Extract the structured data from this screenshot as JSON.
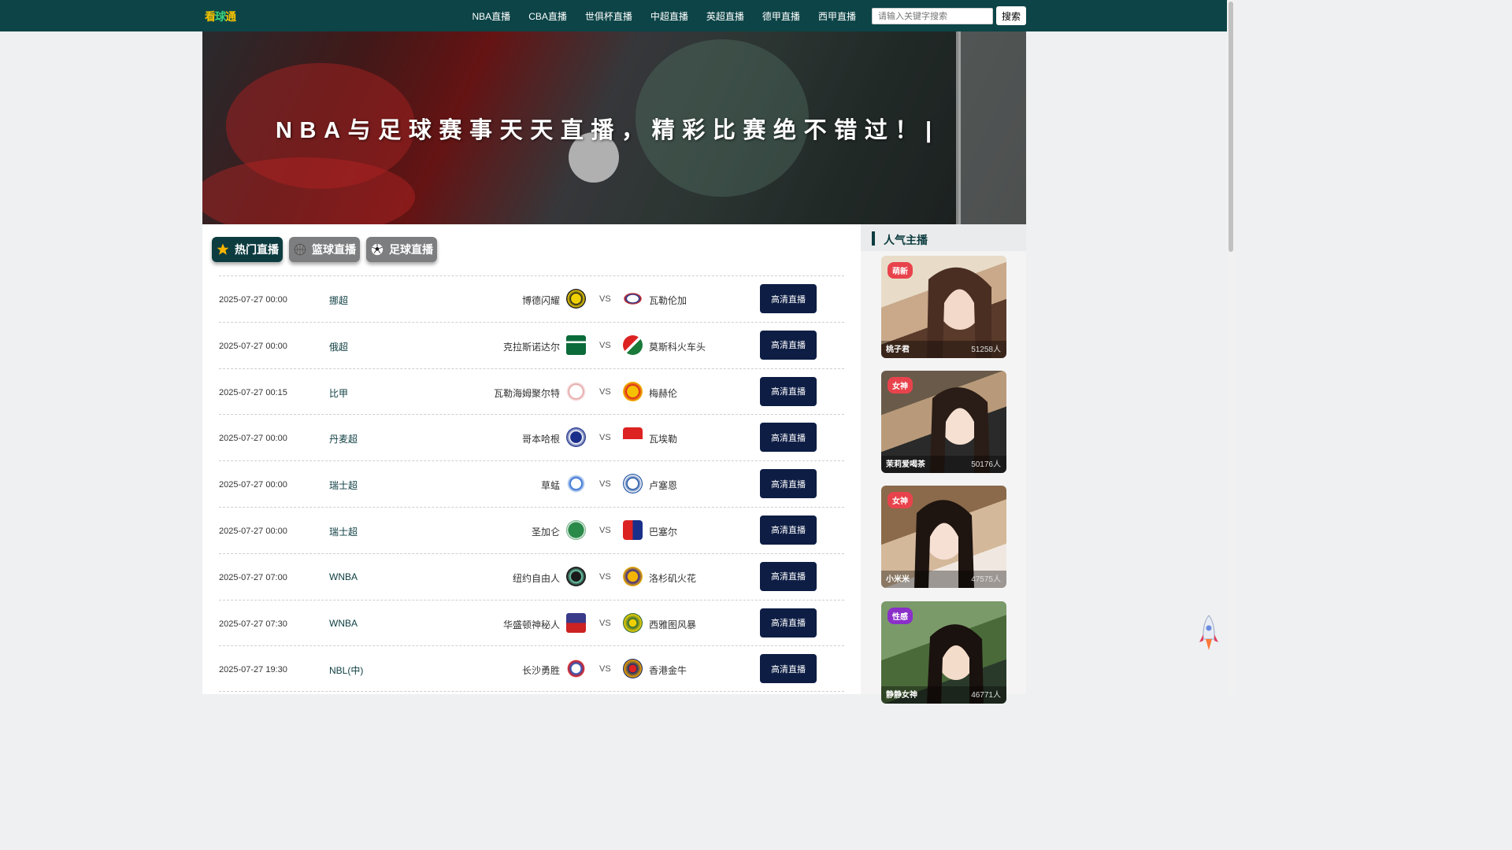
{
  "logo": {
    "parts": [
      "看",
      "球",
      "通"
    ]
  },
  "nav": [
    "NBA直播",
    "CBA直播",
    "世俱杯直播",
    "中超直播",
    "英超直播",
    "德甲直播",
    "西甲直播"
  ],
  "search": {
    "placeholder": "请输入关键字搜索",
    "button": "搜索"
  },
  "banner": {
    "title": "NBA与足球赛事天天直播，精彩比赛绝不错过！|"
  },
  "tabs": [
    {
      "label": "热门直播",
      "icon": "star-icon"
    },
    {
      "label": "篮球直播",
      "icon": "basketball-icon"
    },
    {
      "label": "足球直播",
      "icon": "soccer-ball-icon"
    }
  ],
  "matches": [
    {
      "time": "2025-07-27 00:00",
      "league": "挪超",
      "home": "博德闪耀",
      "vs": "VS",
      "away": "瓦勒伦加",
      "button": "高清直播"
    },
    {
      "time": "2025-07-27 00:00",
      "league": "俄超",
      "home": "克拉斯诺达尔",
      "vs": "VS",
      "away": "莫斯科火车头",
      "button": "高清直播"
    },
    {
      "time": "2025-07-27 00:15",
      "league": "比甲",
      "home": "瓦勒海姆聚尔特",
      "vs": "VS",
      "away": "梅赫伦",
      "button": "高清直播"
    },
    {
      "time": "2025-07-27 00:00",
      "league": "丹麦超",
      "home": "哥本哈根",
      "vs": "VS",
      "away": "瓦埃勒",
      "button": "高清直播"
    },
    {
      "time": "2025-07-27 00:00",
      "league": "瑞士超",
      "home": "草蜢",
      "vs": "VS",
      "away": "卢塞恩",
      "button": "高清直播"
    },
    {
      "time": "2025-07-27 00:00",
      "league": "瑞士超",
      "home": "圣加仑",
      "vs": "VS",
      "away": "巴塞尔",
      "button": "高清直播"
    },
    {
      "time": "2025-07-27 07:00",
      "league": "WNBA",
      "home": "纽约自由人",
      "vs": "VS",
      "away": "洛杉矶火花",
      "button": "高清直播"
    },
    {
      "time": "2025-07-27 07:30",
      "league": "WNBA",
      "home": "华盛顿神秘人",
      "vs": "VS",
      "away": "西雅图风暴",
      "button": "高清直播"
    },
    {
      "time": "2025-07-27 19:30",
      "league": "NBL(中)",
      "home": "长沙勇胜",
      "vs": "VS",
      "away": "香港金牛",
      "button": "高清直播"
    }
  ],
  "sidebar": {
    "title": "人气主播",
    "streamers": [
      {
        "badge": "萌新",
        "name": "桃子君",
        "count": "51258人"
      },
      {
        "badge": "女神",
        "name": "茉莉爱喝茶",
        "count": "50176人"
      },
      {
        "badge": "女神",
        "name": "小米米",
        "count": "47575人"
      },
      {
        "badge": "性感",
        "name": "静静女神",
        "count": "46771人"
      }
    ]
  },
  "colors": {
    "header": "#0c4447",
    "accent": "#0c3c40",
    "live_button": "#0d1d44",
    "badge_new": "#e8434c",
    "badge_goddess": "#e8434c",
    "badge_sexy": "#8b2fc9"
  }
}
